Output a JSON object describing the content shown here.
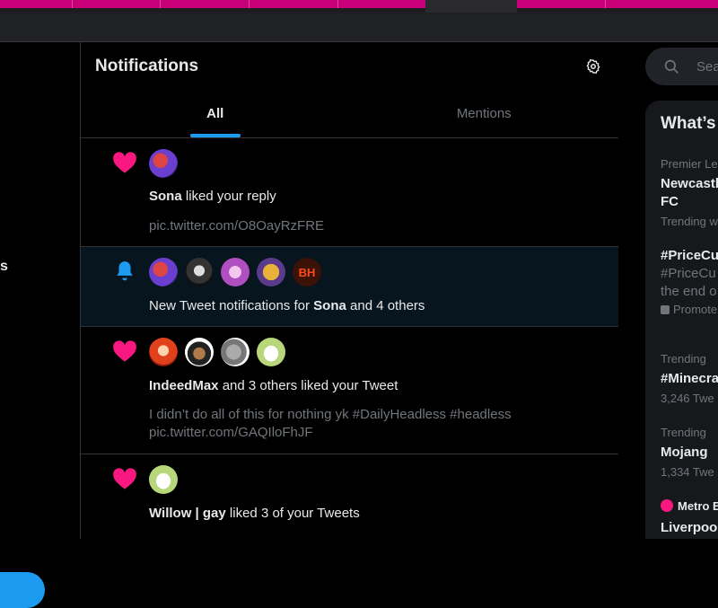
{
  "notifications_page": {
    "title": "Notifications",
    "tabs": [
      {
        "label": "All",
        "active": true
      },
      {
        "label": "Mentions",
        "active": false
      }
    ],
    "items": [
      {
        "type": "like",
        "actor": "Sona",
        "text": "liked your reply",
        "snippet": "pic.twitter.com/O8OayRzFRE"
      },
      {
        "type": "tweet_notification",
        "text_prefix": "New Tweet notifications for",
        "actor": "Sona",
        "text_suffix": "and 4 others",
        "avatar_label": "BH"
      },
      {
        "type": "like",
        "actor": "IndeedMax",
        "text": "and 3 others liked your Tweet",
        "snippet_line1": "I didn’t do all of this for nothing yk #DailyHeadless #headless",
        "snippet_line2": "pic.twitter.com/GAQIloFhJF"
      },
      {
        "type": "like",
        "actor": "Willow | gay",
        "text": "liked 3 of your Tweets"
      }
    ]
  },
  "right_sidebar": {
    "search_placeholder": "Sea",
    "trends_title": "What’s",
    "trends": [
      {
        "meta": "Premier Lea",
        "name_line1": "Newcastl",
        "name_line2": "FC",
        "sub": "Trending w"
      },
      {
        "name": "#PriceCu",
        "desc_line1": "#PriceCu",
        "desc_line2": "the end o",
        "promoted": "Promote"
      },
      {
        "meta": "Trending",
        "name": "#Minecra",
        "sub": "3,246 Twe"
      },
      {
        "meta": "Trending",
        "name": "Mojang",
        "sub": "1,334 Twe"
      },
      {
        "meta": "Metro E",
        "name": "Liverpool"
      }
    ]
  },
  "left_nav": {
    "label_fragment": "s"
  },
  "colors": {
    "accent": "#1d9bf0",
    "like": "#f91880",
    "highlight_bg": "#07151f",
    "browser_tab_pink": "#c9007a"
  }
}
